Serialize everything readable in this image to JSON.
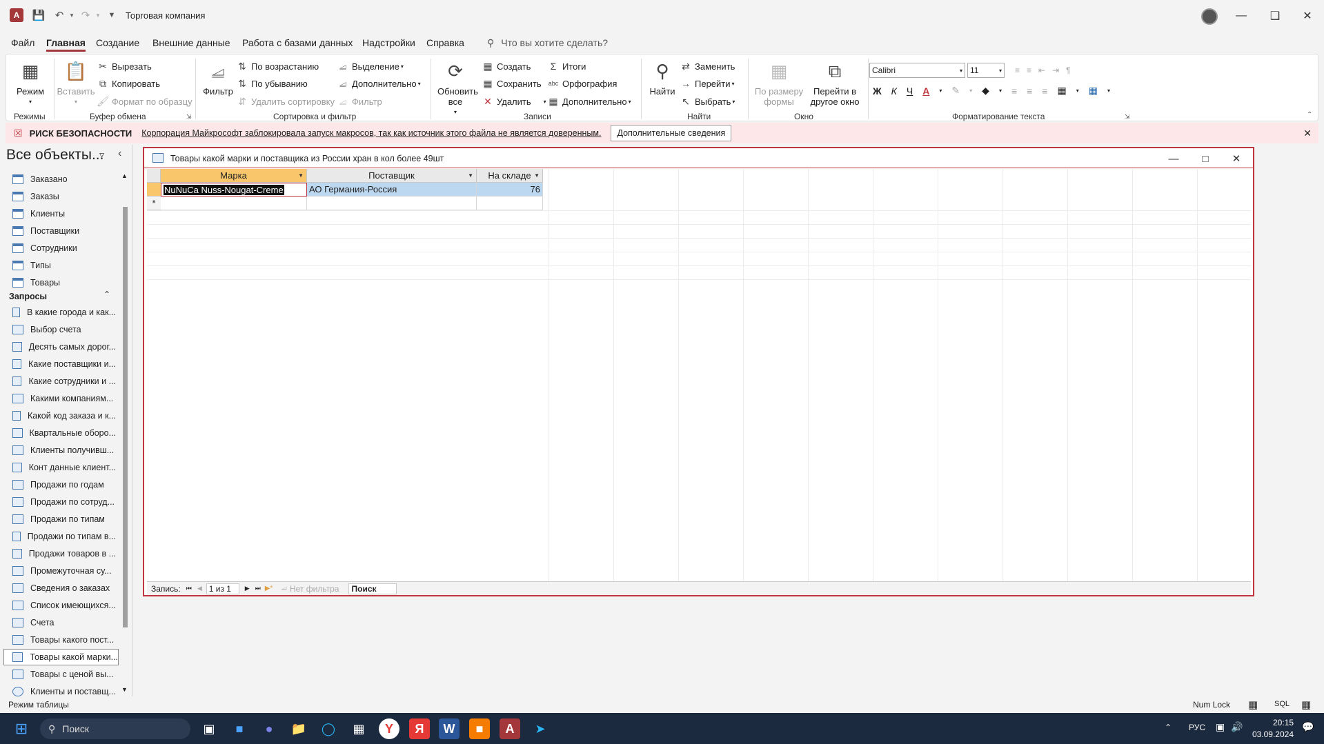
{
  "app": {
    "title": "Торговая компания"
  },
  "menu": {
    "items": [
      "Файл",
      "Главная",
      "Создание",
      "Внешние данные",
      "Работа с базами данных",
      "Надстройки",
      "Справка"
    ],
    "active": "Главная",
    "tell_me": "Что вы хотите сделать?"
  },
  "ribbon": {
    "groups": {
      "modes": "Режимы",
      "clipboard": "Буфер обмена",
      "sort_filter": "Сортировка и фильтр",
      "records": "Записи",
      "find": "Найти",
      "window": "Окно",
      "text_format": "Форматирование текста"
    },
    "mode": "Режим",
    "paste": "Вставить",
    "cut": "Вырезать",
    "copy": "Копировать",
    "format_painter": "Формат по образцу",
    "filter": "Фильтр",
    "ascending": "По возрастанию",
    "descending": "По убыванию",
    "remove_sort": "Удалить сортировку",
    "selection": "Выделение",
    "advanced": "Дополнительно",
    "toggle_filter": "Фильтр",
    "refresh_all": "Обновить все",
    "new": "Создать",
    "save": "Сохранить",
    "delete": "Удалить",
    "totals": "Итоги",
    "spelling": "Орфография",
    "more": "Дополнительно",
    "find": "Найти",
    "replace": "Заменить",
    "goto": "Перейти",
    "select": "Выбрать",
    "size_to_fit": "По размеру формы",
    "switch_windows": "Перейти в другое окно",
    "font": "Calibri",
    "font_size": "11",
    "bold": "Ж",
    "italic": "К",
    "underline": "Ч"
  },
  "security": {
    "label": "РИСК БЕЗОПАСНОСТИ",
    "message": "Корпорация Майкрософт заблокировала запуск макросов, так как источник этого файла не является доверенным.",
    "button": "Дополнительные сведения"
  },
  "nav": {
    "header": "Все объекты...",
    "tables": [
      "Заказано",
      "Заказы",
      "Клиенты",
      "Поставщики",
      "Сотрудники",
      "Типы",
      "Товары"
    ],
    "queries_header": "Запросы",
    "queries": [
      "В какие города и как...",
      "Выбор счета",
      "Десять самых дорог...",
      "Какие поставщики и...",
      "Какие сотрудники и ...",
      "Какими компаниям...",
      "Какой код заказа и к...",
      "Квартальные оборо...",
      "Клиенты получивш...",
      "Конт данные клиент...",
      "Продажи по годам",
      "Продажи по сотруд...",
      "Продажи по типам",
      "Продажи по типам в...",
      "Продажи товаров в ...",
      "Промежуточная су...",
      "Сведения о заказах",
      "Список имеющихся...",
      "Счета",
      "Товары какого пост...",
      "Товары какой марки...",
      "Товары с ценой вы...",
      "Клиенты и поставщ..."
    ],
    "selected_query": "Товары какой марки..."
  },
  "doc": {
    "title": "Товары какой марки и поставщика из России хран в кол более 49шт",
    "columns": [
      "Марка",
      "Поставщик",
      "На складе"
    ],
    "rows": [
      [
        "NuNuCa Nuss-Nougat-Creme",
        "АО Германия-Россия",
        "76"
      ]
    ],
    "new_row_marker": "*",
    "recnav": {
      "label": "Запись:",
      "position": "1 из 1",
      "filter": "Нет фильтра",
      "search": "Поиск"
    }
  },
  "status": {
    "left": "Режим таблицы",
    "numlock": "Num Lock",
    "sql": "SQL"
  },
  "taskbar": {
    "search": "Поиск",
    "lang": "РУС",
    "time": "20:15",
    "date": "03.09.2024"
  },
  "colors": {
    "accent": "#a4373a",
    "selected_header": "#f9c66b",
    "selection_row": "#bcd7f0",
    "security_bg": "#fde7e9"
  }
}
